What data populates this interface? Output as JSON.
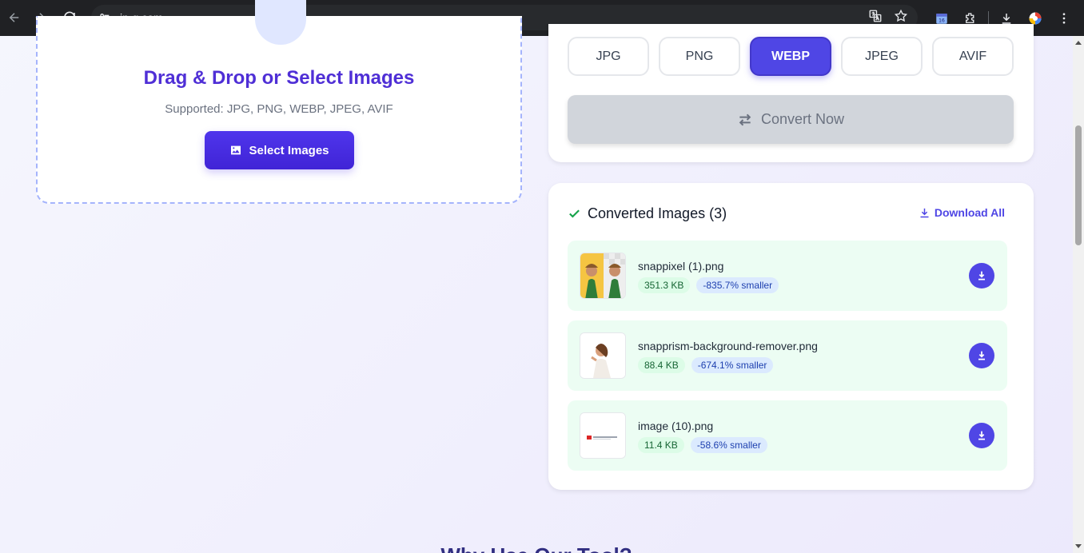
{
  "browser": {
    "url": "jp-g.com"
  },
  "upload": {
    "title": "Drag & Drop or Select Images",
    "supported": "Supported: JPG, PNG, WEBP, JPEG, AVIF",
    "select_label": "Select Images"
  },
  "formats": {
    "options": [
      "JPG",
      "PNG",
      "WEBP",
      "JPEG",
      "AVIF"
    ],
    "selected": "WEBP",
    "convert_label": "Convert Now"
  },
  "converted": {
    "title": "Converted Images (3)",
    "download_all_label": "Download All",
    "files": [
      {
        "name": "snappixel (1).png",
        "size": "351.3 KB",
        "change": "-835.7% smaller"
      },
      {
        "name": "snapprism-background-remover.png",
        "size": "88.4 KB",
        "change": "-674.1% smaller"
      },
      {
        "name": "image (10).png",
        "size": "11.4 KB",
        "change": "-58.6% smaller"
      }
    ]
  },
  "section": {
    "heading": "Why Use Our Tool?"
  },
  "colors": {
    "accent": "#4f46e5",
    "success": "#16a34a"
  }
}
